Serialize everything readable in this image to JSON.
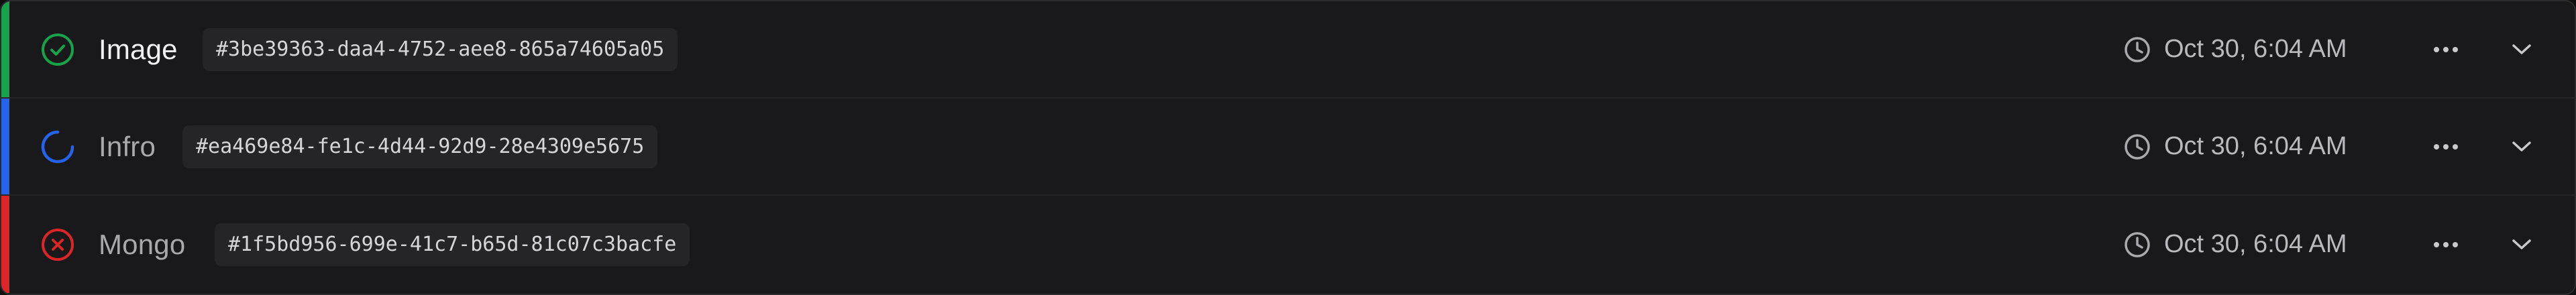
{
  "colors": {
    "success": "#22c55e",
    "running": "#3b82f6",
    "error": "#ef4444"
  },
  "rows": [
    {
      "name": "Image",
      "id": "#3be39363-daa4-4752-aee8-865a74605a05",
      "time": "Oct 30, 6:04 AM",
      "status": "success",
      "status_icon": "check-circle-icon",
      "accent_color": "#22c55e"
    },
    {
      "name": "Infro",
      "id": "#ea469e84-fe1c-4d44-92d9-28e4309e5675",
      "time": "Oct 30, 6:04 AM",
      "status": "running",
      "status_icon": "spinner-icon",
      "accent_color": "#3b82f6"
    },
    {
      "name": "Mongo",
      "id": "#1f5bd956-699e-41c7-b65d-81c07c3bacfe",
      "time": "Oct 30, 6:04 AM",
      "status": "error",
      "status_icon": "x-circle-icon",
      "accent_color": "#ef4444"
    }
  ]
}
